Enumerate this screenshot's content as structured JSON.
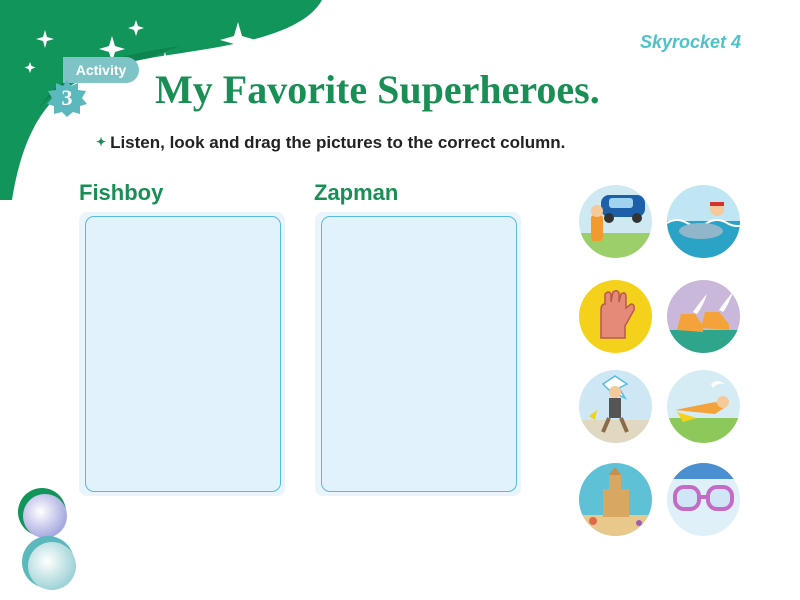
{
  "header": {
    "brand": "Skyrocket 4",
    "activity_label": "Activity",
    "activity_number": "3",
    "title": "My Favorite Superheroes."
  },
  "instruction": "Listen, look and drag the pictures to the correct column.",
  "columns": [
    {
      "label": "Fishboy"
    },
    {
      "label": "Zapman"
    }
  ],
  "pictures": [
    {
      "id": "car",
      "icon": "lifting-car-icon"
    },
    {
      "id": "dolphin",
      "icon": "dolphin-rider-icon"
    },
    {
      "id": "gloves",
      "icon": "gloves-icon"
    },
    {
      "id": "winged-shoes",
      "icon": "winged-shoes-icon"
    },
    {
      "id": "zapped-man",
      "icon": "zapped-man-icon"
    },
    {
      "id": "flying",
      "icon": "flying-hero-icon"
    },
    {
      "id": "sandcastle",
      "icon": "sandcastle-icon"
    },
    {
      "id": "goggles",
      "icon": "goggles-icon"
    }
  ],
  "colors": {
    "primary_green": "#1a8f55",
    "zone_border": "#58b9e2",
    "activity_tag": "#7ec4c7"
  }
}
